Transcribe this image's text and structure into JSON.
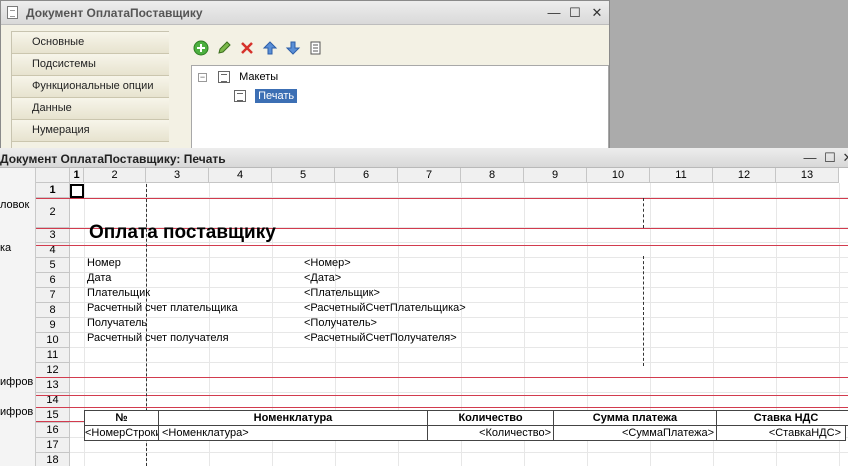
{
  "window1": {
    "title": "Документ ОплатаПоставщику",
    "sidebar": [
      "Основные",
      "Подсистемы",
      "Функциональные опции",
      "Данные",
      "Нумерация"
    ],
    "tree": {
      "root": "Макеты",
      "child": "Печать"
    }
  },
  "window2": {
    "title": "Документ ОплатаПоставщику: Печать",
    "groups": [
      "ловок",
      "ка",
      "ифров",
      "ифров"
    ],
    "columns": [
      "1",
      "2",
      "3",
      "4",
      "5",
      "6",
      "7",
      "8",
      "9",
      "10",
      "11",
      "12",
      "13"
    ],
    "rows": [
      "1",
      "2",
      "3",
      "4",
      "5",
      "6",
      "7",
      "8",
      "9",
      "10",
      "11",
      "12",
      "13",
      "14",
      "15",
      "16",
      "17",
      "18"
    ],
    "title_cell": "Оплата поставщику",
    "fields": [
      {
        "label": "Номер",
        "param": "<Номер>"
      },
      {
        "label": "Дата",
        "param": "<Дата>"
      },
      {
        "label": "Плательщик",
        "param": "<Плательщик>"
      },
      {
        "label": "Расчетный счет плательщика",
        "param": "<РасчетныйСчетПлательщика>"
      },
      {
        "label": "Получатель",
        "param": "<Получатель>"
      },
      {
        "label": "Расчетный счет получателя",
        "param": "<РасчетныйСчетПолучателя>"
      }
    ],
    "table": {
      "headers": [
        "№",
        "Номенклатура",
        "Количество",
        "Сумма платежа",
        "Ставка НДС"
      ],
      "row": [
        "<НомерСтроки>",
        "<Номенклатура>",
        "<Количество>",
        "<СуммаПлатежа>",
        "<СтавкаНДС>"
      ]
    }
  }
}
